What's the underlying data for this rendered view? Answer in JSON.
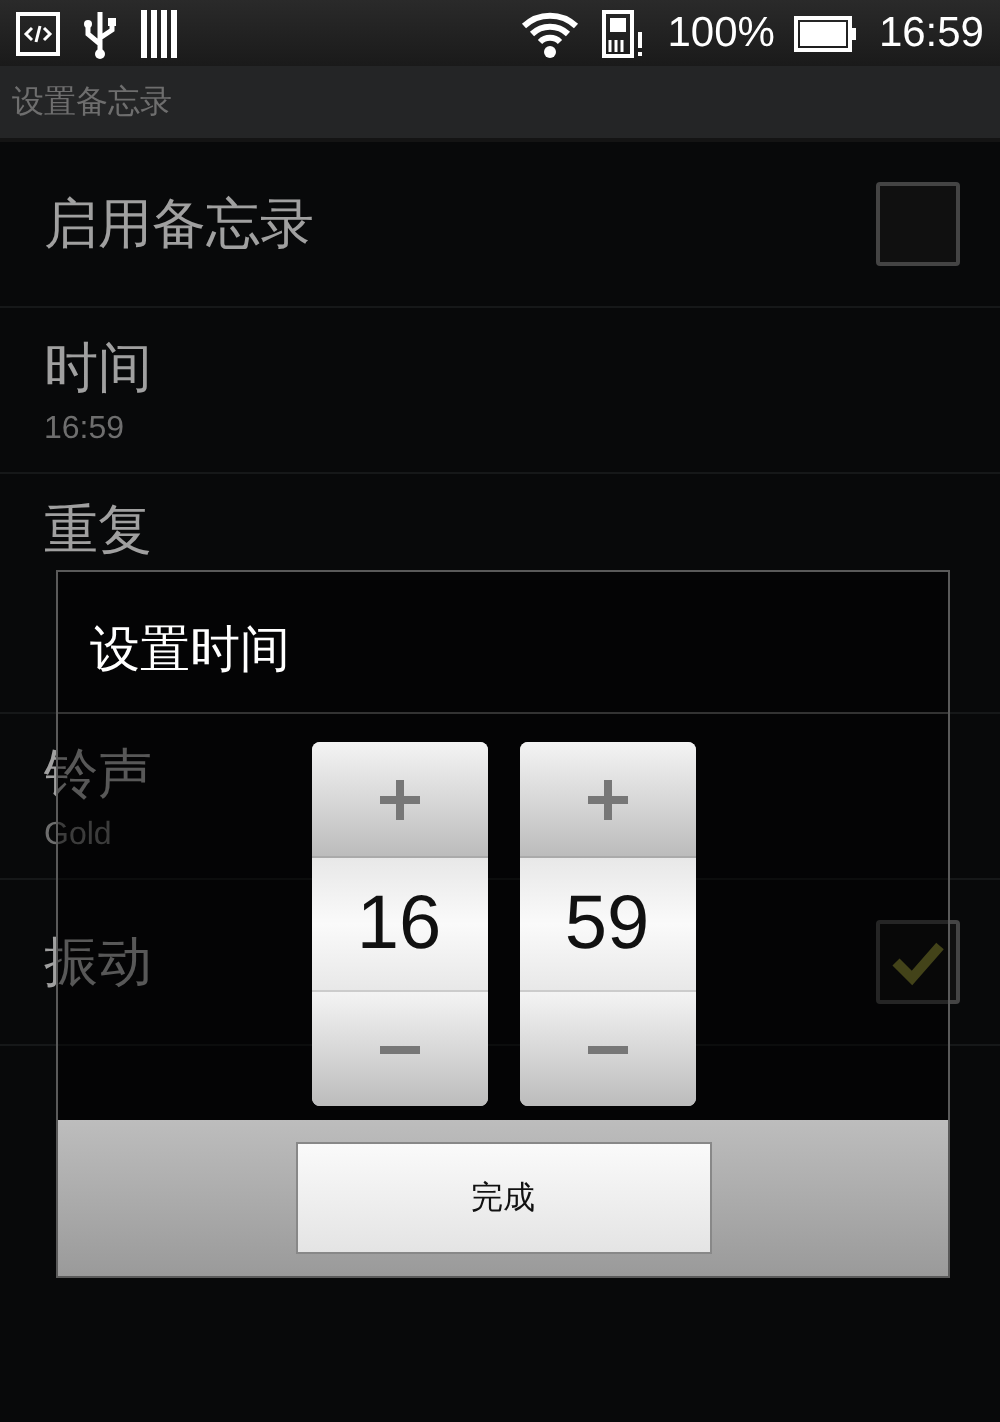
{
  "status_bar": {
    "battery_percent": "100%",
    "time": "16:59"
  },
  "app_bar": {
    "title": "设置备忘录"
  },
  "settings": [
    {
      "kind": "checkbox",
      "title": "启用备忘录",
      "checked": false
    },
    {
      "kind": "value",
      "title": "时间",
      "summary": "16:59"
    },
    {
      "kind": "value",
      "title": "重复"
    },
    {
      "kind": "value",
      "title": "铃声",
      "summary": "Gold"
    },
    {
      "kind": "checkbox",
      "title": "振动",
      "checked": true
    }
  ],
  "dialog": {
    "title": "设置时间",
    "pickers": [
      {
        "value": "16"
      },
      {
        "value": "59"
      }
    ],
    "buttons": [
      "完成"
    ]
  }
}
